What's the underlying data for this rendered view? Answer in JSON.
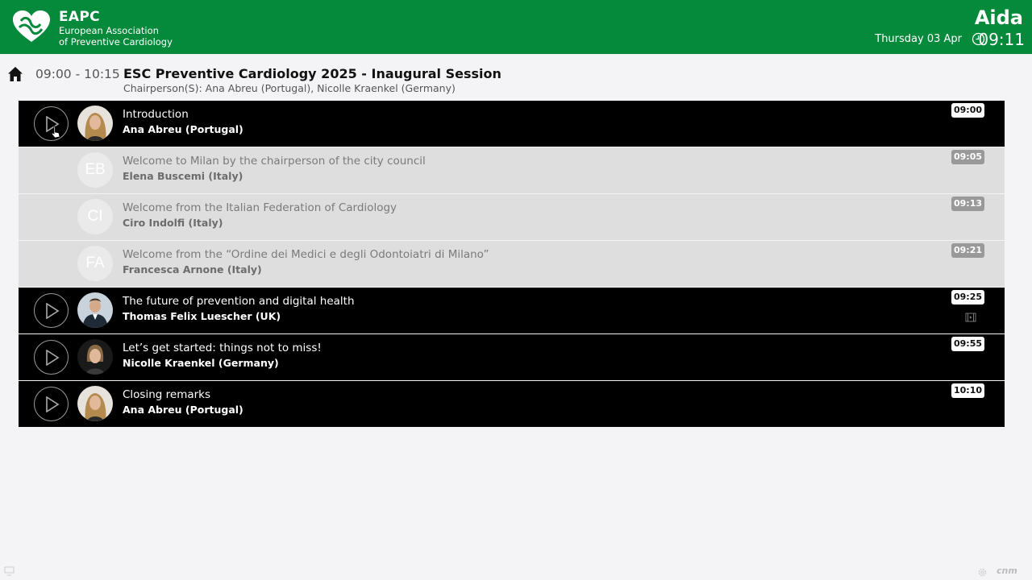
{
  "header": {
    "brand_title": "EAPC",
    "brand_line1": "European Association",
    "brand_line2": "of Preventive Cardiology",
    "user_name": "Aida",
    "date": "Thursday 03 Apr",
    "time": "09:11",
    "bg_color": "#05893a"
  },
  "session": {
    "time_range": "09:00 - 10:15",
    "title": "ESC Preventive Cardiology 2025 - Inaugural Session",
    "chair_label": "Chairperson(S):",
    "chairs": "Ana Abreu (Portugal), Nicolle Kraenkel (Germany)"
  },
  "talks": [
    {
      "title": "Introduction",
      "speaker": "Ana Abreu (Portugal)",
      "time": "09:00",
      "state": "active",
      "avatar": "photo-woman-blonde"
    },
    {
      "title": "Welcome to Milan by the chairperson of the city council",
      "speaker": "Elena Buscemi (Italy)",
      "time": "09:05",
      "state": "dim",
      "initials": "EB"
    },
    {
      "title": "Welcome from the Italian Federation of Cardiology",
      "speaker": "Ciro Indolfi (Italy)",
      "time": "09:13",
      "state": "dim",
      "initials": "CI"
    },
    {
      "title": "Welcome from the “Ordine dei Medici e degli Odontoiatri di Milano”",
      "speaker": "Francesca Arnone (Italy)",
      "time": "09:21",
      "state": "dim",
      "initials": "FA"
    },
    {
      "title": "The future of prevention and digital health",
      "speaker": "Thomas Felix Luescher (UK)",
      "time": "09:25",
      "state": "active",
      "avatar": "photo-man-suit",
      "video": true
    },
    {
      "title": "Let’s get started: things not to miss!",
      "speaker": "Nicolle Kraenkel (Germany)",
      "time": "09:55",
      "state": "active",
      "avatar": "photo-woman-short-hair"
    },
    {
      "title": "Closing remarks",
      "speaker": "Ana Abreu (Portugal)",
      "time": "10:10",
      "state": "active",
      "avatar": "photo-woman-blonde"
    }
  ],
  "footer": {
    "brand": "cnm"
  }
}
